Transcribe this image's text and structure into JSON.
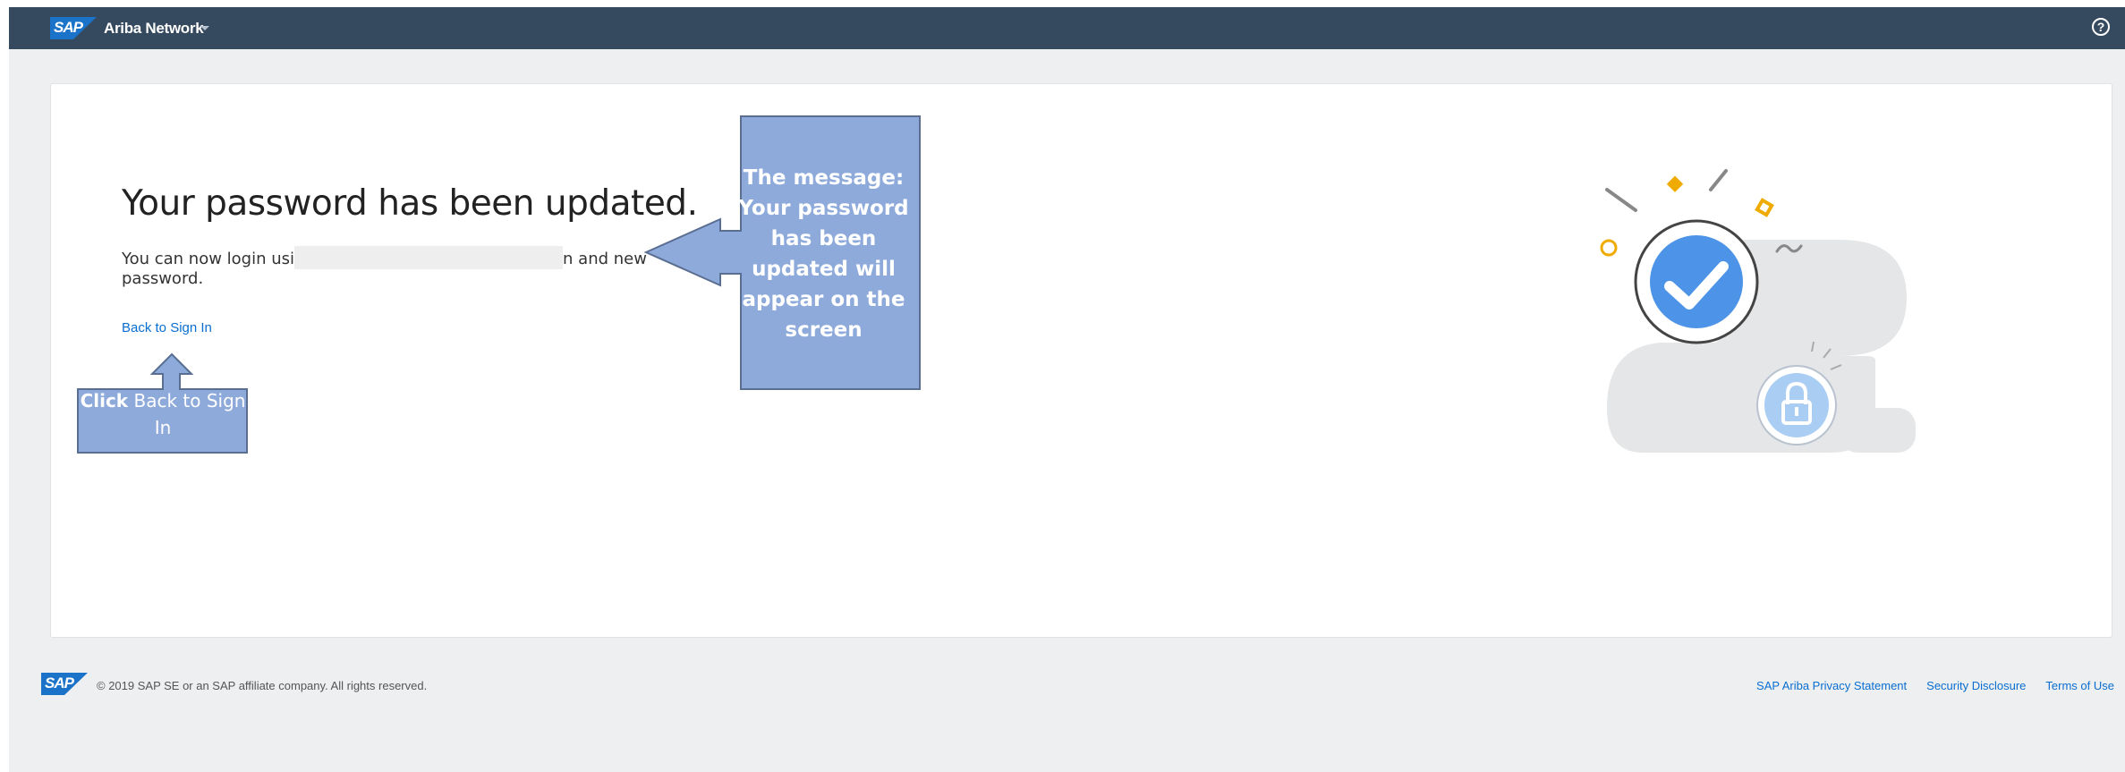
{
  "header": {
    "logo_text": "SAP",
    "app_name": "Ariba Network",
    "help_icon": "question-circle-icon",
    "background_color": "#354a5f"
  },
  "main": {
    "heading": "Your password has been updated.",
    "message_before": "You can now login usi",
    "message_after": "n and new password.",
    "back_link": "Back to Sign In",
    "illustration_icons": [
      "check-mark-icon",
      "lock-icon",
      "cloud-icon"
    ]
  },
  "annotations": {
    "click_callout_bold": "Click",
    "click_callout_rest": " Back to Sign In",
    "message_callout": "The message: Your password has been updated will appear on the screen",
    "callout_color": "#8eaadb"
  },
  "footer": {
    "logo_text": "SAP",
    "copyright": "© 2019 SAP SE or an SAP affiliate company. All rights reserved.",
    "links": [
      "SAP Ariba Privacy Statement",
      "Security Disclosure",
      "Terms of Use"
    ]
  },
  "colors": {
    "link": "#0a6ed1",
    "accent_yellow": "#f0ab00",
    "check_blue": "#5aa0f0"
  }
}
